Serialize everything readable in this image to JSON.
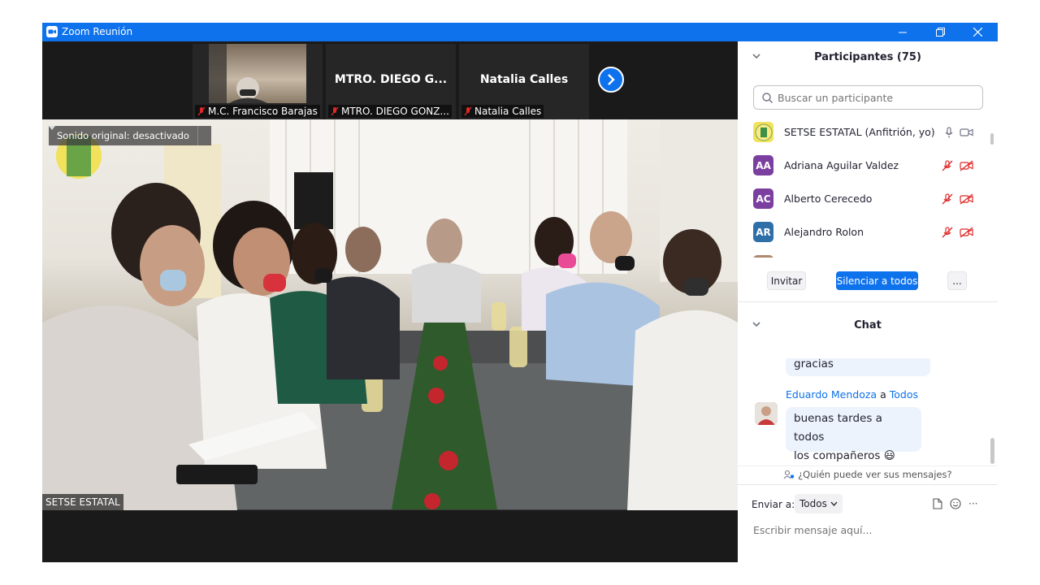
{
  "window": {
    "title": "Zoom Reunión",
    "accent": "#0e72ed"
  },
  "filmstrip": {
    "tiles": [
      {
        "label": "M.C. Francisco Barajas",
        "name": "",
        "has_video": true
      },
      {
        "label": "MTRO. DIEGO GONZ...",
        "name": "MTRO. DIEGO G...",
        "has_video": false
      },
      {
        "label": "Natalia Calles",
        "name": "Natalia Calles",
        "has_video": false
      }
    ],
    "next_icon": "chevron-right-icon"
  },
  "main_video": {
    "original_sound": "Sonido original: desactivado",
    "speaker_name": "SETSE ESTATAL"
  },
  "participants": {
    "title": "Participantes (75)",
    "search_placeholder": "Buscar un participante",
    "list": [
      {
        "name": "SETSE ESTATAL (Anfitrión, yo)",
        "initials": "",
        "color": "#f2e15a",
        "muted": false
      },
      {
        "name": "Adriana Aguilar Valdez",
        "initials": "AA",
        "color": "#7b3fa0",
        "muted": true
      },
      {
        "name": "Alberto Cerecedo",
        "initials": "AC",
        "color": "#7b3fa0",
        "muted": true
      },
      {
        "name": "Alejandro Rolon",
        "initials": "AR",
        "color": "#2f6fa8",
        "muted": true
      }
    ],
    "invite_label": "Invitar",
    "mute_all_label": "Silenciar a todos",
    "more_label": "..."
  },
  "chat": {
    "title": "Chat",
    "prev_message": "gracias",
    "sender": "Eduardo Mendoza",
    "to_word": "a",
    "recipient": "Todos",
    "message_line1": "buenas tardes a todos",
    "message_line2": "los compañeros",
    "emoji": "😃",
    "who_can_see": "¿Quién puede ver sus mensajes?",
    "send_to_label": "Enviar a:",
    "send_to_value": "Todos",
    "input_placeholder": "Escribir mensaje aquí...",
    "more_label": "···"
  }
}
